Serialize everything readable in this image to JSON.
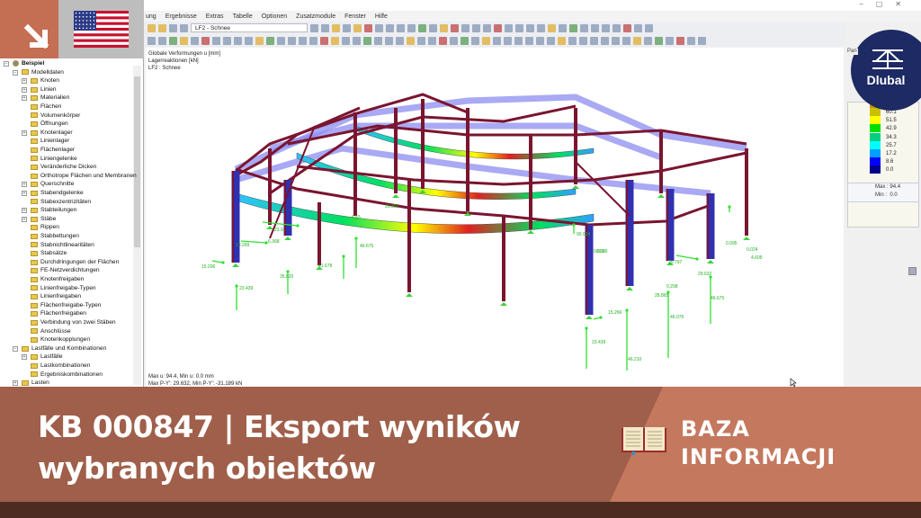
{
  "menu": [
    "ung",
    "Ergebnisse",
    "Extras",
    "Tabelle",
    "Optionen",
    "Zusatzmodule",
    "Fenster",
    "Hilfe"
  ],
  "loadcase_combo": "LF2 - Schnee",
  "tree": [
    {
      "label": "Beispiel",
      "level": 0
    },
    {
      "label": "Modelldaten",
      "level": 1
    },
    {
      "label": "Knoten",
      "level": 2
    },
    {
      "label": "Linien",
      "level": 2
    },
    {
      "label": "Materialien",
      "level": 2
    },
    {
      "label": "Flächen",
      "level": 2
    },
    {
      "label": "Volumenkörper",
      "level": 2
    },
    {
      "label": "Öffnungen",
      "level": 2
    },
    {
      "label": "Knotenlager",
      "level": 2
    },
    {
      "label": "Linienlager",
      "level": 2
    },
    {
      "label": "Flächenlager",
      "level": 2
    },
    {
      "label": "Liniengelenke",
      "level": 2
    },
    {
      "label": "Veränderliche Dicken",
      "level": 2
    },
    {
      "label": "Orthotrope Flächen und Membranen",
      "level": 2
    },
    {
      "label": "Querschnitte",
      "level": 2
    },
    {
      "label": "Stabendgelenke",
      "level": 2
    },
    {
      "label": "Stabexzentrizitäten",
      "level": 2
    },
    {
      "label": "Stabteilungen",
      "level": 2
    },
    {
      "label": "Stäbe",
      "level": 2
    },
    {
      "label": "Rippen",
      "level": 2
    },
    {
      "label": "Stabbettungen",
      "level": 2
    },
    {
      "label": "Stabnichtlinearitäten",
      "level": 2
    },
    {
      "label": "Stabsätze",
      "level": 2
    },
    {
      "label": "Durchdringungen der Flächen",
      "level": 2
    },
    {
      "label": "FE-Netzverdichtungen",
      "level": 2
    },
    {
      "label": "Knotenfreigaben",
      "level": 2
    },
    {
      "label": "Linienfreigabe-Typen",
      "level": 2
    },
    {
      "label": "Linienfreigaben",
      "level": 2
    },
    {
      "label": "Flächenfreigabe-Typen",
      "level": 2
    },
    {
      "label": "Flächenfreigaben",
      "level": 2
    },
    {
      "label": "Verbindung von zwei Stäben",
      "level": 2
    },
    {
      "label": "Anschlüsse",
      "level": 2
    },
    {
      "label": "Knotenkopplungen",
      "level": 2
    },
    {
      "label": "Lastfälle und Kombinationen",
      "level": 1
    },
    {
      "label": "Lastfälle",
      "level": 2
    },
    {
      "label": "Lastkombinationen",
      "level": 2
    },
    {
      "label": "Ergebniskombinationen",
      "level": 2
    },
    {
      "label": "Lasten",
      "level": 1
    }
  ],
  "canvas": {
    "info": [
      "Globale Verformungen u [mm]",
      "Lagerreaktionen [kN]",
      "LF2 : Schnee"
    ],
    "footer": [
      "Max u: 94.4, Min u: 0.0 mm",
      "Max P-Y': 29.632, Min P-Y': -31.189 kN"
    ],
    "reactions": [
      "15.206",
      "23.299",
      "23.439",
      "35.820",
      "6.368",
      "23.9",
      "41.678",
      "6.55",
      "46.675",
      "26.853",
      "0.026",
      "90.004",
      "0.095",
      "0.024",
      "4.605",
      "25.797",
      "29.632",
      "0.298",
      "28.865",
      "46.075",
      "46.675",
      "46.210",
      "23.439",
      "15.266",
      "0.026"
    ]
  },
  "legend": {
    "values": [
      "60.1",
      "51.5",
      "42.9",
      "34.3",
      "25.7",
      "17.2",
      "8.6",
      "0.0"
    ],
    "colors": [
      "#c8c000",
      "#ffff00",
      "#00e000",
      "#00d080",
      "#00ffff",
      "#00a0ff",
      "#0000ff",
      "#00008c"
    ],
    "max_label": "Max",
    "max": "94.4",
    "min_label": "Min",
    "min": "0.0"
  },
  "panel_title": "Pan",
  "brand": "Dlubal",
  "banner": {
    "line1": "KB 000847 | Eksport wyników",
    "line2": "wybranych obiektów",
    "kb1": "BAZA",
    "kb2": "INFORMACJI"
  }
}
